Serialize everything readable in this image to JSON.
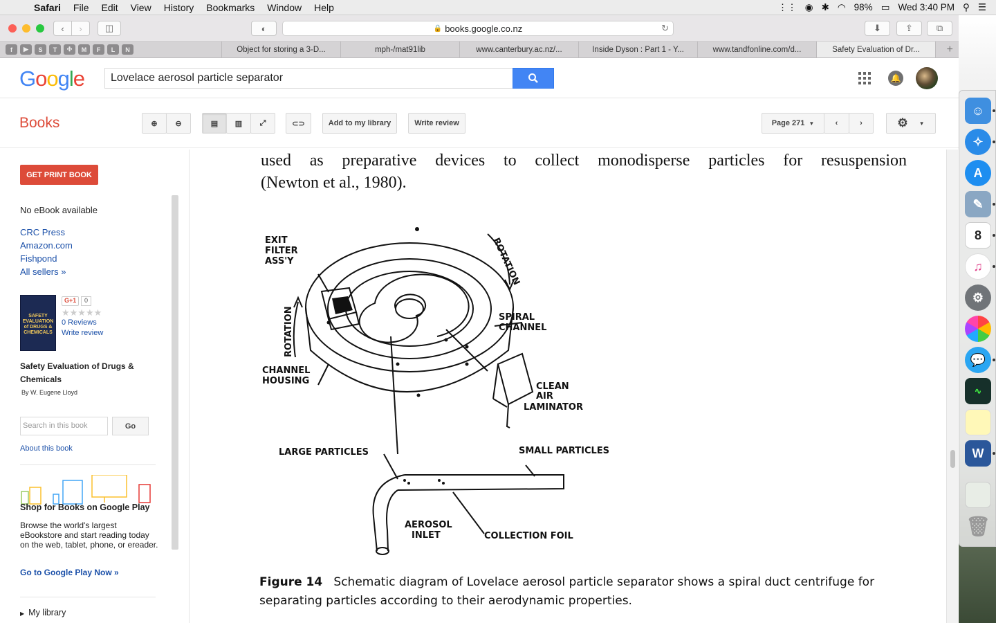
{
  "menubar": {
    "apple": "",
    "items": [
      "Safari",
      "File",
      "Edit",
      "View",
      "History",
      "Bookmarks",
      "Window",
      "Help"
    ],
    "battery": "98%",
    "clock": "Wed 3:40 PM"
  },
  "browser": {
    "url": "books.google.co.nz",
    "pinned_tabs": [
      "f",
      "▶",
      "S",
      "T",
      "✣",
      "M",
      "F",
      "L",
      "N"
    ],
    "tabs": [
      "Object for storing a 3-D...",
      "mph-/mat91lib",
      "www.canterbury.ac.nz/...",
      "Inside Dyson : Part 1 - Y...",
      "www.tandfonline.com/d...",
      "Safety Evaluation of Dr..."
    ],
    "active_tab_index": 5
  },
  "google": {
    "logo_letters": [
      "G",
      "o",
      "o",
      "g",
      "l",
      "e"
    ],
    "search_query": "Lovelace aerosol particle separator"
  },
  "toolbar": {
    "section_title": "Books",
    "add_to_library": "Add to my library",
    "write_review": "Write review",
    "page_label": "Page 271"
  },
  "sidebar": {
    "get_print_book": "GET PRINT BOOK",
    "no_ebook": "No eBook available",
    "sellers": [
      "CRC Press",
      "Amazon.com",
      "Fishpond",
      "All sellers »"
    ],
    "cover_text": "SAFETY EVALUATION of DRUGS & CHEMICALS",
    "gplus": "G+1",
    "gplus_count": "0",
    "stars": "★★★★★",
    "reviews": "0 Reviews",
    "write_review": "Write review",
    "book_title": "Safety Evaluation of Drugs & Chemicals",
    "byline": "By W. Eugene Lloyd",
    "search_placeholder": "Search in this book",
    "go": "Go",
    "about": "About this book",
    "shop_title": "Shop for Books on Google Play",
    "shop_desc": "Browse the world's largest eBookstore and start reading today on the web, tablet, phone, or ereader.",
    "shop_link": "Go to Google Play Now »",
    "my_library": "My library"
  },
  "page": {
    "line1": "used as preparative devices to collect monodisperse particles for resuspension",
    "line2": "(Newton et al., 1980).",
    "figure_labels": {
      "exit_filter_1": "EXIT",
      "exit_filter_2": "FILTER",
      "exit_filter_3": "ASS'Y",
      "rotation_top": "ROTATION",
      "rotation_left": "ROTATION",
      "spiral_1": "SPIRAL",
      "spiral_2": "CHANNEL",
      "housing_1": "CHANNEL",
      "housing_2": "HOUSING",
      "clean_1": "CLEAN",
      "clean_2": "AIR",
      "clean_3": "LAMINATOR",
      "large": "LARGE PARTICLES",
      "small": "SMALL PARTICLES",
      "aerosol_1": "AEROSOL",
      "aerosol_2": "INLET",
      "foil": "COLLECTION FOIL"
    },
    "caption_label": "Figure 14",
    "caption_text": "Schematic diagram of Lovelace aerosol particle separator shows a spiral duct centrifuge for separating particles according to their aerodynamic properties."
  },
  "colors": {
    "books_red": "#dd4b39",
    "google_blue": "#4285f4",
    "link_blue": "#1a4fa8"
  }
}
